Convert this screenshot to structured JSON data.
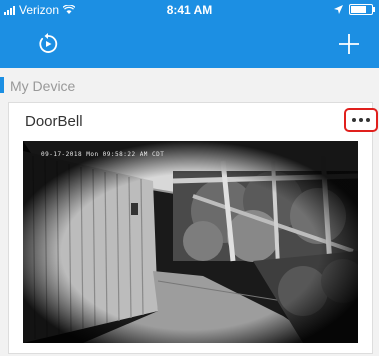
{
  "status_bar": {
    "carrier": "Verizon",
    "time": "8:41 AM",
    "icons": [
      "signal-icon",
      "wifi-icon",
      "location-icon",
      "battery-icon"
    ]
  },
  "nav": {
    "left_icon": "replay-icon",
    "right_icon": "plus-icon",
    "accent": "#1c8fe3"
  },
  "section": {
    "title": "My Device"
  },
  "device": {
    "name": "DoorBell",
    "more_icon": "more-dots-icon",
    "highlight_color": "#e0201d",
    "camera": {
      "timestamp": "09-17-2018 Mon 09:58:22 AM CDT"
    }
  }
}
